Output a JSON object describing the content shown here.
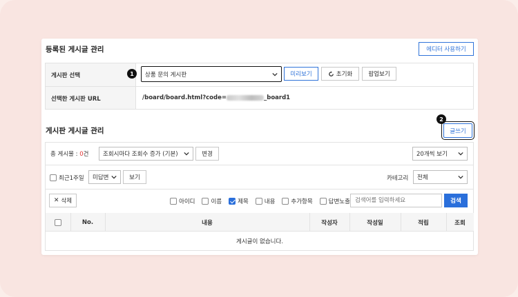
{
  "registered": {
    "title": "등록된 게시글 관리",
    "editor_button": "에디터 사용하기",
    "board_select_label": "게시판 선택",
    "board_select_value": "상품 문의 게시판",
    "preview_button": "미리보기",
    "reset_button": "초기화",
    "popup_button": "팝업보기",
    "url_label": "선택한 게시판 URL",
    "url_prefix": "/board/board.html?code=",
    "url_suffix": "_board1"
  },
  "markers": [
    "1",
    "2"
  ],
  "manage": {
    "title": "게시판 게시글 관리",
    "write_button": "글쓰기",
    "total_label": "총 게시물 : ",
    "total_count": "0",
    "total_unit": "건",
    "sort_select": "조회시마다 조회수 증가 (기본)",
    "change_button": "변경",
    "page_size_select": "20개씩 보기",
    "recent_label": "최근1주일",
    "answer_select": "미답변",
    "view_button": "보기",
    "category_label": "카테고리",
    "category_select": "전체"
  },
  "search": {
    "delete_button": "삭제",
    "filters": [
      {
        "label": "아이디",
        "checked": false
      },
      {
        "label": "이름",
        "checked": false
      },
      {
        "label": "제목",
        "checked": true
      },
      {
        "label": "내용",
        "checked": false
      },
      {
        "label": "추가항목",
        "checked": false
      },
      {
        "label": "답변노출",
        "checked": false
      }
    ],
    "placeholder": "검색어를 입력하세요",
    "search_button": "검색"
  },
  "table": {
    "columns": [
      "No.",
      "내용",
      "작성자",
      "작성일",
      "적립",
      "조회"
    ],
    "empty_message": "게시글이 없습니다."
  },
  "colors": {
    "accent": "#2a6fdb",
    "count": "#e03131",
    "background": "#f9e5e1"
  }
}
